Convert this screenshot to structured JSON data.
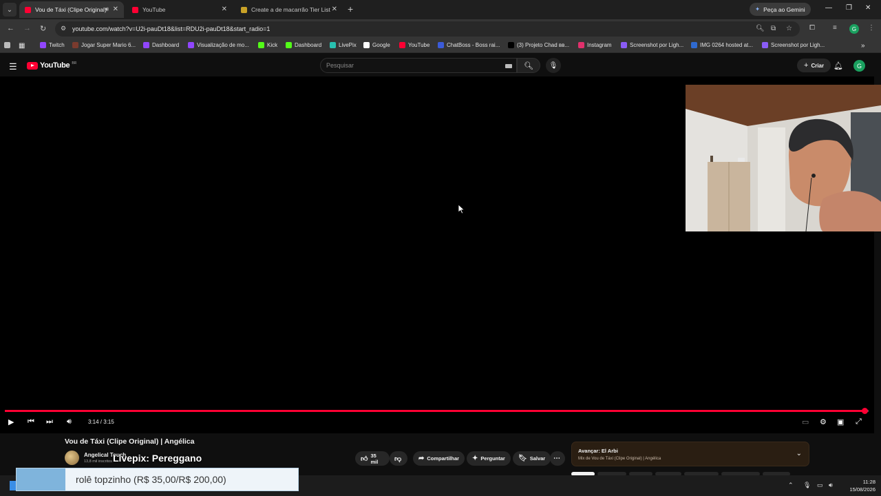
{
  "browser": {
    "tabs": [
      {
        "title": "Vou de Táxi (Clipe Original)",
        "active": true
      },
      {
        "title": "YouTube",
        "active": false
      },
      {
        "title": "Create a de macarrão Tier List",
        "active": false
      }
    ],
    "gemini_label": "Peça ao Gemini",
    "url": "youtube.com/watch?v=U2i-pauDt18&list=RDU2i-pauDt18&start_radio=1",
    "profile_initial": "G"
  },
  "bookmarks": [
    {
      "label": "Twitch",
      "color": "#9146ff"
    },
    {
      "label": "Jogar Super Mario 6...",
      "color": "#7a3b2e"
    },
    {
      "label": "Dashboard",
      "color": "#9146ff"
    },
    {
      "label": "Visualização de mo...",
      "color": "#9146ff"
    },
    {
      "label": "Kick",
      "color": "#53fc18"
    },
    {
      "label": "Dashboard",
      "color": "#53fc18"
    },
    {
      "label": "LivePix",
      "color": "#28c0b0"
    },
    {
      "label": "Google",
      "color": "#ffffff"
    },
    {
      "label": "YouTube",
      "color": "#ff0033"
    },
    {
      "label": "ChatBoss - Boss rai...",
      "color": "#3b5bd9"
    },
    {
      "label": "(3) Projeto Chad вв...",
      "color": "#000000"
    },
    {
      "label": "Instagram",
      "color": "#e1306c"
    },
    {
      "label": "Screenshot por Ligh...",
      "color": "#8a5cf6"
    },
    {
      "label": "IMG 0264 hosted at...",
      "color": "#2f6ad0"
    },
    {
      "label": "Screenshot por Ligh...",
      "color": "#8a5cf6"
    }
  ],
  "youtube": {
    "logo_text": "YouTube",
    "logo_country": "BR",
    "search_placeholder": "Pesquisar",
    "create_label": "Criar",
    "avatar_initial": "G"
  },
  "player": {
    "time": "3:14 / 3:15",
    "progress_fraction": 0.995
  },
  "video": {
    "title": "Vou de Táxi (Clipe Original) | Angélica",
    "channel": "Angelical Touch",
    "subscribers": "13,8 mil inscritos",
    "overlay_name": "Livepix: Pereggano",
    "likes": "35 mil",
    "share_label": "Compartilhar",
    "ask_label": "Perguntar",
    "save_label": "Salvar"
  },
  "mix": {
    "next_label": "Avançar: El Arbi",
    "subtitle": "Mix de Vou de Táxi (Clipe Original) | Angélica"
  },
  "alert": {
    "text": "rolê topzinho (R$ 35,00/R$ 200,00)"
  },
  "taskbar": {
    "time": "11:28",
    "date": "15/08/2026"
  },
  "colors": {
    "accent": "#ff0033",
    "background": "#0f0f0f"
  }
}
